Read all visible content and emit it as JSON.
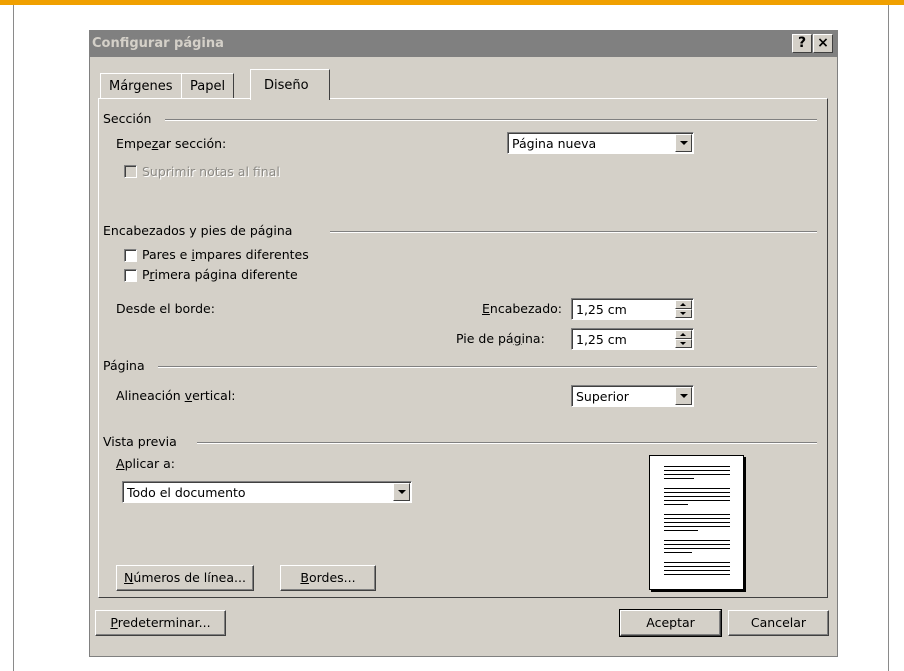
{
  "dialog": {
    "title": "Configurar página",
    "help_button": "?",
    "close_button": "×"
  },
  "tabs": [
    {
      "label": "Márgenes",
      "active": false
    },
    {
      "label": "Papel",
      "active": false
    },
    {
      "label": "Diseño",
      "active": true
    }
  ],
  "section": {
    "header": "Sección",
    "start_label_pre": "Empe",
    "start_label_u": "z",
    "start_label_post": "ar sección:",
    "start_value": "Página nueva",
    "suppress_endnotes": "Suprimir notas al final"
  },
  "headers_footers": {
    "header": "Encabezados y pies de página",
    "odd_even_pre": "Pares e ",
    "odd_even_u": "i",
    "odd_even_post": "mpares diferentes",
    "first_page_pre": "P",
    "first_page_u": "r",
    "first_page_post": "imera página diferente",
    "from_edge": "Desde el borde:",
    "header_label_u": "E",
    "header_label_post": "ncabezado:",
    "header_value": "1,25 cm",
    "footer_label_pre": "Pie de pá",
    "footer_label_u": "g",
    "footer_label_post": "ina:",
    "footer_value": "1,25 cm"
  },
  "page": {
    "header": "Página",
    "valign_pre": "Alineación ",
    "valign_u": "v",
    "valign_post": "ertical:",
    "valign_value": "Superior"
  },
  "preview": {
    "header": "Vista previa",
    "apply_u": "A",
    "apply_post": "plicar a:",
    "apply_value": "Todo el documento",
    "line_numbers_u": "N",
    "line_numbers_post": "úmeros de línea...",
    "borders_u": "B",
    "borders_post": "ordes..."
  },
  "footer_buttons": {
    "default_u": "P",
    "default_post": "redeterminar...",
    "ok": "Aceptar",
    "cancel": "Cancelar"
  },
  "colors": {
    "accent_bar": "#f0a000",
    "dialog_face": "#d4d0c8",
    "inactive_title": "#808080"
  }
}
